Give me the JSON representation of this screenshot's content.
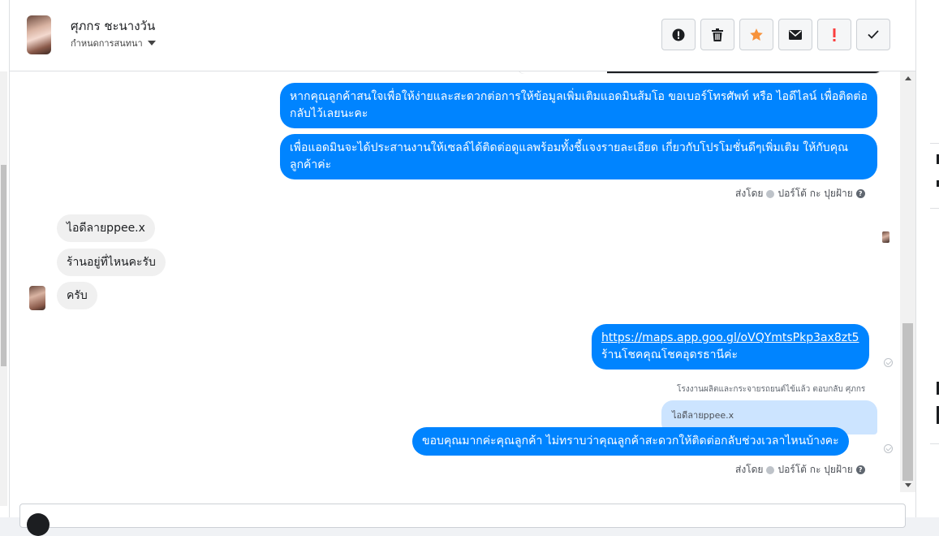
{
  "header": {
    "contact_name": "ศุภกร ชะนางวัน",
    "conversation_settings": "กำหนดการสนทนา"
  },
  "toolbar": {
    "buttons": [
      {
        "icon": "alert-circle-icon"
      },
      {
        "icon": "trash-icon"
      },
      {
        "icon": "star-icon",
        "color": "#f7923b"
      },
      {
        "icon": "envelope-icon"
      },
      {
        "icon": "exclamation-icon",
        "color": "#fa3e3e"
      },
      {
        "icon": "check-icon"
      }
    ]
  },
  "messages": {
    "out_1": "หากคุณลูกค้าสนใจเพื่อให้ง่ายและสะดวกต่อการให้ข้อมูลเพิ่มเติมแอดมินส้มโอ ขอเบอร์โทรศัพท์ หรือ ไอดีไลน์ เพื่อติดต่อกลับไว้เลยนะคะ",
    "out_2": "เพื่อแอดมินจะได้ประสานงานให้เซลล์ได้ติดต่อดูแลพร้อมทั้งชี้แจงรายละเอียด เกี่ยวกับโปรโมชั่นดีๆเพิ่มเติม ให้กับคุณลูกค้าค่ะ",
    "sent_by_1": {
      "prefix": "ส่งโดย",
      "page": "ปอร์โต้ กะ ปุยฝ้าย"
    },
    "in_1": "ไอดีลายppee.x",
    "in_2": "ร้านอยู่ที่ไหนคะรับ",
    "in_3": "ครับ",
    "out_3_link": "https://maps.app.goo.gl/oVQYmtsPkp3ax8zt5",
    "out_3_text": "ร้านโชคคุณโชคอุดรธานีค่ะ",
    "reply_note": "โรงงานผลิตและกระจายรถยนต์ไข้แล้ว ตอบกลับ ศุภกร",
    "reply_quote": "ไอดีลายppee.x",
    "out_4": "ขอบคุณมากค่ะคุณลูกค้า ไม่ทราบว่าคุณลูกค้าสะดวกให้ติดต่อกลับช่วงเวลาไหนบ้างคะ",
    "sent_by_2": {
      "prefix": "ส่งโดย",
      "page": "ปอร์โต้ กะ ปุยฝ้าย"
    }
  },
  "colors": {
    "outgoing_bubble": "#0084ff",
    "incoming_bubble": "#f0f0f0",
    "reply_quote": "#cce4ff"
  }
}
